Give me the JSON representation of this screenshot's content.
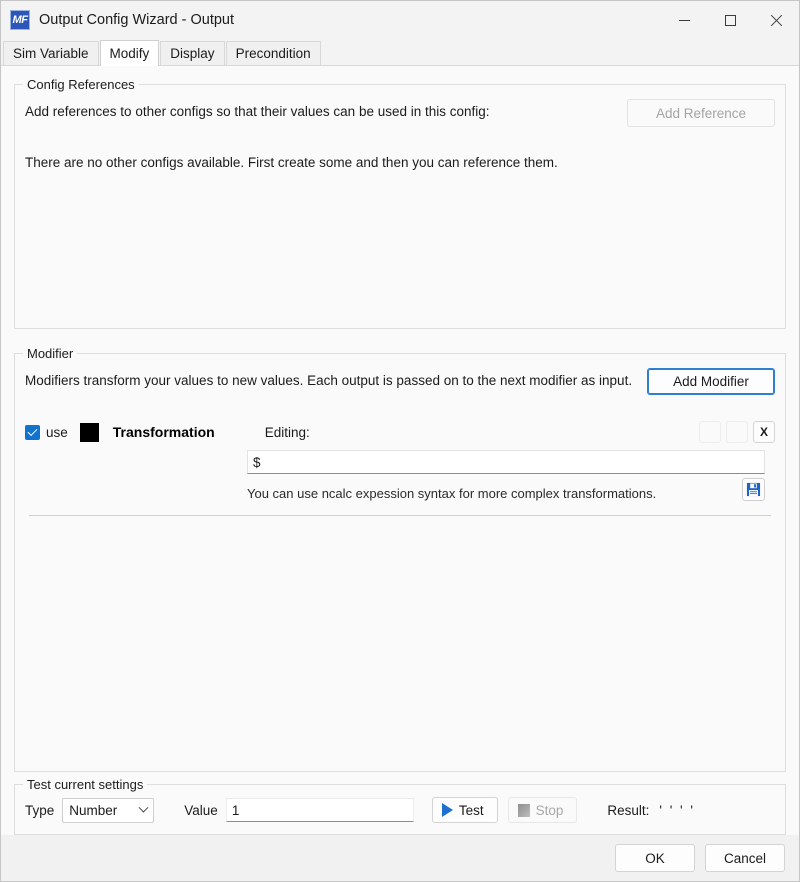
{
  "window": {
    "title": "Output Config Wizard - Output",
    "app_icon": "mf-app-icon",
    "app_icon_text": "MF",
    "controls": {
      "minimize": "minimize-icon",
      "maximize": "maximize-icon",
      "close": "close-icon"
    }
  },
  "tabs": [
    {
      "label": "Sim Variable",
      "active": false
    },
    {
      "label": "Modify",
      "active": true
    },
    {
      "label": "Display",
      "active": false
    },
    {
      "label": "Precondition",
      "active": false
    }
  ],
  "config_references": {
    "title": "Config References",
    "description": "Add references to other configs so that their values can be used in this config:",
    "empty_message": "There are no other configs available. First create some and then you can reference them.",
    "add_button": "Add Reference",
    "add_button_enabled": false
  },
  "modifier": {
    "title": "Modifier",
    "description": "Modifiers transform your values to new values. Each output is passed on to the next modifier as input.",
    "add_button": "Add Modifier",
    "entry": {
      "use_checked": true,
      "use_label": "use",
      "color": "#000000",
      "name": "Transformation",
      "editing_label": "Editing:",
      "expression_value": "$",
      "expression_placeholder": "",
      "hint": "You can use ncalc expession syntax for more complex transformations.",
      "move_up_label": "",
      "move_down_label": "",
      "delete_label": "X",
      "save_icon": "save-floppy-icon"
    }
  },
  "test": {
    "title": "Test current settings",
    "type_label": "Type",
    "type_value": "Number",
    "type_options": [
      "Number"
    ],
    "value_label": "Value",
    "value_text": "1",
    "test_button": "Test",
    "stop_button": "Stop",
    "stop_enabled": false,
    "result_label": "Result:",
    "result_value": "' ' ' '"
  },
  "footer": {
    "ok": "OK",
    "cancel": "Cancel"
  },
  "colors": {
    "accent": "#1273cf",
    "focus": "#2f7fd1",
    "swatch": "#000000"
  }
}
